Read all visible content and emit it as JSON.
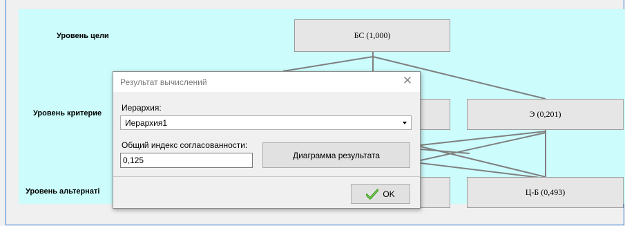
{
  "hierarchy": {
    "levels": {
      "goal": "Уровень цели",
      "criteria": "Уровень критерие",
      "alternatives": "Уровень альтернаті"
    },
    "nodes": {
      "goal": "БС (1,000)",
      "criterion_e": "Э (0,201)",
      "alternative_cb": "Ц-Б (0,493)"
    },
    "colors": {
      "canvas": "#ccfcfc",
      "node": "#e6e6e6",
      "link": "#7f7f7f"
    }
  },
  "dialog": {
    "title": "Результат вычислений",
    "close_icon": "close-icon",
    "hierarchy_label": "Иерархия:",
    "hierarchy_value": "Иерархия1",
    "consistency_label": "Общий индекс согласованности:",
    "consistency_value": "0,125",
    "diagram_button": "Диаграмма результата",
    "ok_button": "OK",
    "ok_icon": "checkmark-icon"
  }
}
